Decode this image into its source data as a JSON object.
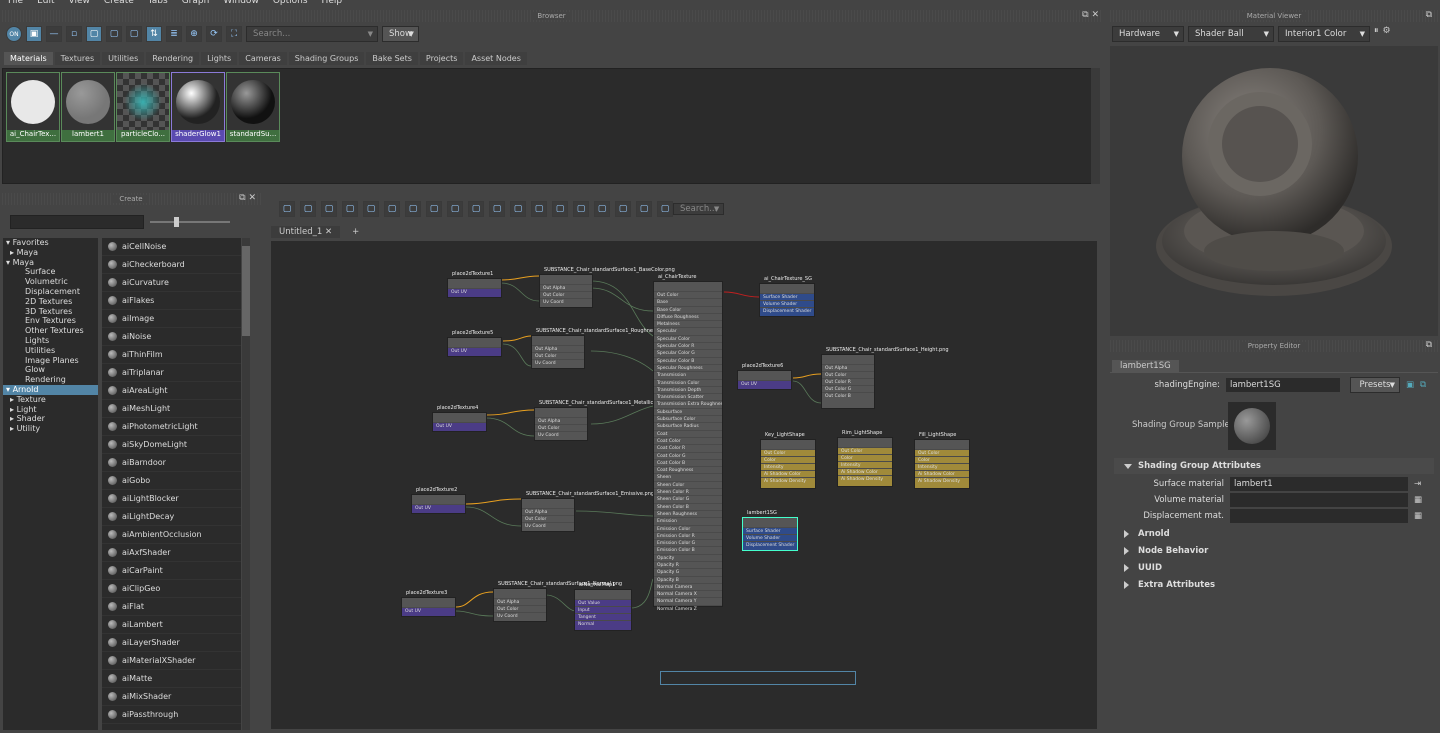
{
  "menu": [
    "File",
    "Edit",
    "View",
    "Create",
    "Tabs",
    "Graph",
    "Window",
    "Options",
    "Help"
  ],
  "browser": {
    "title": "Browser",
    "search_placeholder": "Search...",
    "show_label": "Show",
    "tabs": [
      "Materials",
      "Textures",
      "Utilities",
      "Rendering",
      "Lights",
      "Cameras",
      "Shading Groups",
      "Bake Sets",
      "Projects",
      "Asset Nodes"
    ],
    "swatches": [
      {
        "label": "ai_ChairTex...",
        "color": "#e8e8e8"
      },
      {
        "label": "lambert1",
        "color": "#777777"
      },
      {
        "label": "particleClo...",
        "color": "#2a8a8a"
      },
      {
        "label": "shaderGlow1",
        "color": "#222222"
      },
      {
        "label": "standardSu...",
        "color": "#111111"
      }
    ]
  },
  "create": {
    "title": "Create",
    "tree": [
      {
        "label": "Favorites",
        "level": 0
      },
      {
        "label": "Maya",
        "level": 1
      },
      {
        "label": "Maya",
        "level": 0
      },
      {
        "label": "Surface",
        "level": 2
      },
      {
        "label": "Volumetric",
        "level": 2
      },
      {
        "label": "Displacement",
        "level": 2
      },
      {
        "label": "2D Textures",
        "level": 2
      },
      {
        "label": "3D Textures",
        "level": 2
      },
      {
        "label": "Env Textures",
        "level": 2
      },
      {
        "label": "Other Textures",
        "level": 2
      },
      {
        "label": "Lights",
        "level": 2
      },
      {
        "label": "Utilities",
        "level": 2
      },
      {
        "label": "Image Planes",
        "level": 2
      },
      {
        "label": "Glow",
        "level": 2
      },
      {
        "label": "Rendering",
        "level": 2
      },
      {
        "label": "Arnold",
        "level": 0,
        "selected": true
      },
      {
        "label": "Texture",
        "level": 1
      },
      {
        "label": "Light",
        "level": 1
      },
      {
        "label": "Shader",
        "level": 1
      },
      {
        "label": "Utility",
        "level": 1
      }
    ],
    "nodes": [
      "aiCellNoise",
      "aiCheckerboard",
      "aiCurvature",
      "aiFlakes",
      "aiImage",
      "aiNoise",
      "aiThinFilm",
      "aiTriplanar",
      "aiAreaLight",
      "aiMeshLight",
      "aiPhotometricLight",
      "aiSkyDomeLight",
      "aiBarndoor",
      "aiGobo",
      "aiLightBlocker",
      "aiLightDecay",
      "aiAmbientOcclusion",
      "aiAxfShader",
      "aiCarPaint",
      "aiClipGeo",
      "aiFlat",
      "aiLambert",
      "aiLayerShader",
      "aiMaterialXShader",
      "aiMatte",
      "aiMixShader",
      "aiPassthrough"
    ]
  },
  "graph": {
    "search_placeholder": "Search...",
    "tab": "Untitled_1",
    "add_tab": "+",
    "nodes": {
      "p1": "place2dTexture1",
      "p5": "place2dTexture5",
      "p4": "place2dTexture4",
      "p2": "place2dTexture2",
      "p6": "place2dTexture6",
      "p3": "place2dTexture3",
      "t_base": "SUBSTANCE_Chair_standardSurface1_BaseColor.png",
      "t_rough": "SUBSTANCE_Chair_standardSurface1_Roughness.png",
      "t_metal": "SUBSTANCE_Chair_standardSurface1_Metallic.png",
      "t_emis": "SUBSTANCE_Chair_standardSurface1_Emissive.png",
      "t_norm": "SUBSTANCE_Chair_standardSurface1_Normal.png",
      "t_height": "SUBSTANCE_Chair_standardSurface1_Height.png",
      "normalmap": "aiNormalMap1",
      "chair": "ai_ChairTexture",
      "sg": "ai_ChairTexture_SG",
      "lambertsg": "lambert1SG",
      "key": "Key_LightShape",
      "rim": "Rim_LightShape",
      "fill": "Fill_LightShape",
      "out_uv": "Out UV",
      "out_alpha": "Out Alpha",
      "out_color": "Out Color",
      "uv_coord": "Uv Coord",
      "out_value": "Out Value",
      "sg_rows": [
        "Surface Shader",
        "Volume Shader",
        "Displacement Shader"
      ],
      "light_rows": [
        "Color",
        "Intensity",
        "Ai Shadow Color",
        "Ai Shadow Density"
      ],
      "nm_rows": [
        "Input",
        "Tangent",
        "Normal"
      ],
      "chair_rows": [
        "Base",
        "Base Color",
        "Diffuse Roughness",
        "Metalness",
        "Specular",
        "Specular Color",
        "Specular Color R",
        "Specular Color G",
        "Specular Color B",
        "Specular Roughness",
        "Transmission",
        "Transmission Color",
        "Transmission Depth",
        "Transmission Scatter",
        "Transmission Extra Roughness",
        "Subsurface",
        "Subsurface Color",
        "Subsurface Radius",
        "Coat",
        "Coat Color",
        "Coat Color R",
        "Coat Color G",
        "Coat Color B",
        "Coat Roughness",
        "Sheen",
        "Sheen Color",
        "Sheen Color R",
        "Sheen Color G",
        "Sheen Color B",
        "Sheen Roughness",
        "Emission",
        "Emission Color",
        "Emission Color R",
        "Emission Color G",
        "Emission Color B",
        "Opacity",
        "Opacity R",
        "Opacity G",
        "Opacity B",
        "Normal Camera",
        "Normal Camera X",
        "Normal Camera Y",
        "Normal Camera Z"
      ],
      "height_rows": [
        "Out Alpha",
        "Out Color",
        "Out Color R",
        "Out Color G",
        "Out Color B"
      ]
    }
  },
  "viewer": {
    "title": "Material Viewer",
    "renderer": "Hardware",
    "geometry": "Shader Ball",
    "environment": "Interior1 Color"
  },
  "props": {
    "title": "Property Editor",
    "tab": "lambert1SG",
    "engine_label": "shadingEngine:",
    "engine_value": "lambert1SG",
    "presets": "Presets",
    "sample_label": "Shading Group Sample",
    "section": "Shading Group Attributes",
    "surface_label": "Surface material",
    "surface_value": "lambert1",
    "volume_label": "Volume material",
    "disp_label": "Displacement mat.",
    "collapsed": [
      "Arnold",
      "Node Behavior",
      "UUID",
      "Extra Attributes"
    ]
  }
}
